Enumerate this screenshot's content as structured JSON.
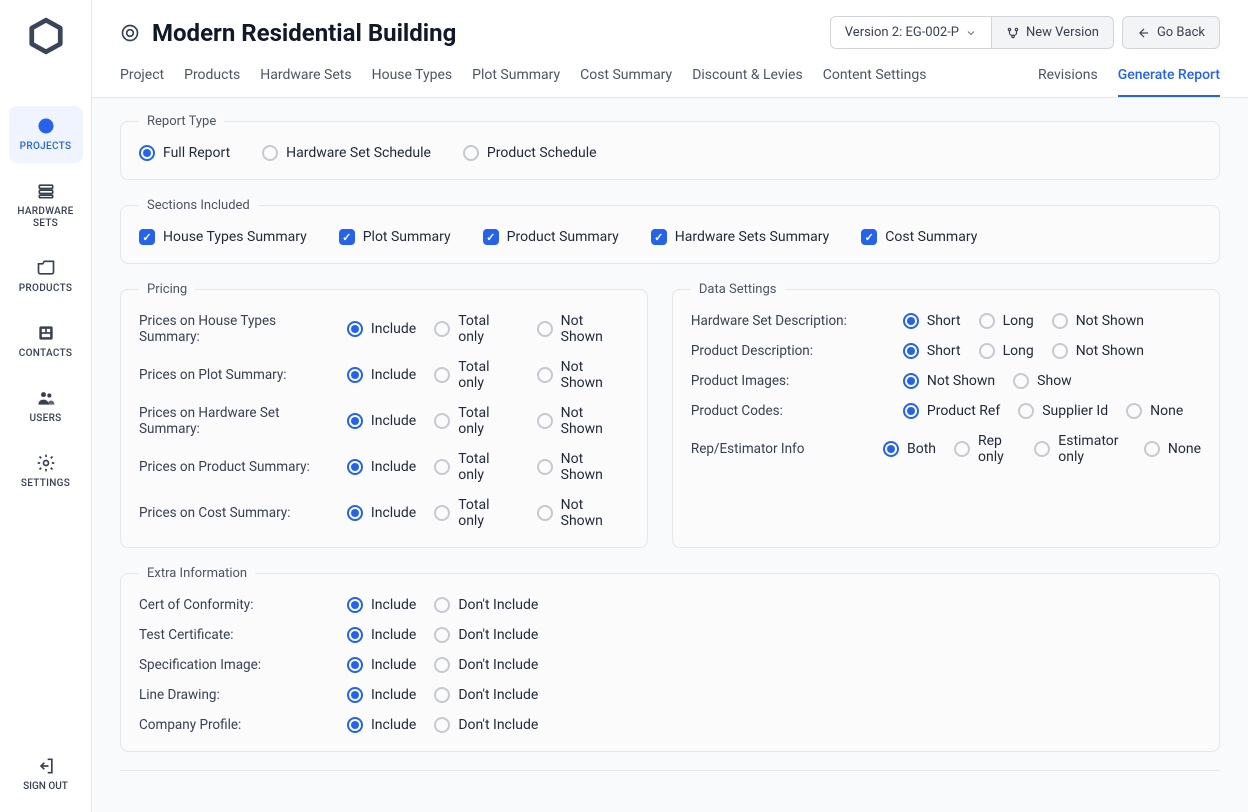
{
  "sidebar": {
    "items": [
      {
        "label": "PROJECTS"
      },
      {
        "label": "HARDWARE SETS"
      },
      {
        "label": "PRODUCTS"
      },
      {
        "label": "CONTACTS"
      },
      {
        "label": "USERS"
      },
      {
        "label": "SETTINGS"
      }
    ],
    "signout_label": "SIGN OUT"
  },
  "header": {
    "title": "Modern Residential Building",
    "version_btn": "Version 2: EG-002-P",
    "new_version_btn": "New Version",
    "go_back_btn": "Go Back",
    "tabs": [
      {
        "label": "Project"
      },
      {
        "label": "Products"
      },
      {
        "label": "Hardware Sets"
      },
      {
        "label": "House Types"
      },
      {
        "label": "Plot Summary"
      },
      {
        "label": "Cost Summary"
      },
      {
        "label": "Discount & Levies"
      },
      {
        "label": "Content Settings"
      }
    ],
    "right_tabs": [
      {
        "label": "Revisions"
      },
      {
        "label": "Generate Report"
      }
    ]
  },
  "report_type": {
    "legend": "Report Type",
    "options": [
      "Full Report",
      "Hardware Set Schedule",
      "Product Schedule"
    ]
  },
  "sections": {
    "legend": "Sections Included",
    "options": [
      "House Types Summary",
      "Plot Summary",
      "Product Summary",
      "Hardware Sets Summary",
      "Cost Summary"
    ]
  },
  "pricing": {
    "legend": "Pricing",
    "rows": [
      {
        "label": "Prices on House Types Summary:",
        "options": [
          "Include",
          "Total only",
          "Not Shown"
        ]
      },
      {
        "label": "Prices on Plot Summary:",
        "options": [
          "Include",
          "Total only",
          "Not Shown"
        ]
      },
      {
        "label": "Prices on Hardware Set Summary:",
        "options": [
          "Include",
          "Total only",
          "Not Shown"
        ]
      },
      {
        "label": "Prices on Product Summary:",
        "options": [
          "Include",
          "Total only",
          "Not Shown"
        ]
      },
      {
        "label": "Prices on Cost Summary:",
        "options": [
          "Include",
          "Total only",
          "Not Shown"
        ]
      }
    ]
  },
  "data_settings": {
    "legend": "Data Settings",
    "rows": [
      {
        "label": "Hardware Set Description:",
        "options": [
          "Short",
          "Long",
          "Not Shown"
        ]
      },
      {
        "label": "Product Description:",
        "options": [
          "Short",
          "Long",
          "Not Shown"
        ]
      },
      {
        "label": "Product Images:",
        "options": [
          "Not Shown",
          "Show"
        ]
      },
      {
        "label": "Product Codes:",
        "options": [
          "Product Ref",
          "Supplier Id",
          "None"
        ]
      },
      {
        "label": "Rep/Estimator Info",
        "options": [
          "Both",
          "Rep only",
          "Estimator only",
          "None"
        ]
      }
    ]
  },
  "extra": {
    "legend": "Extra Information",
    "rows": [
      {
        "label": "Cert of Conformity:",
        "options": [
          "Include",
          "Don't Include"
        ]
      },
      {
        "label": "Test Certificate:",
        "options": [
          "Include",
          "Don't Include"
        ]
      },
      {
        "label": "Specification Image:",
        "options": [
          "Include",
          "Don't Include"
        ]
      },
      {
        "label": "Line Drawing:",
        "options": [
          "Include",
          "Don't Include"
        ]
      },
      {
        "label": "Company Profile:",
        "options": [
          "Include",
          "Don't Include"
        ]
      }
    ]
  }
}
